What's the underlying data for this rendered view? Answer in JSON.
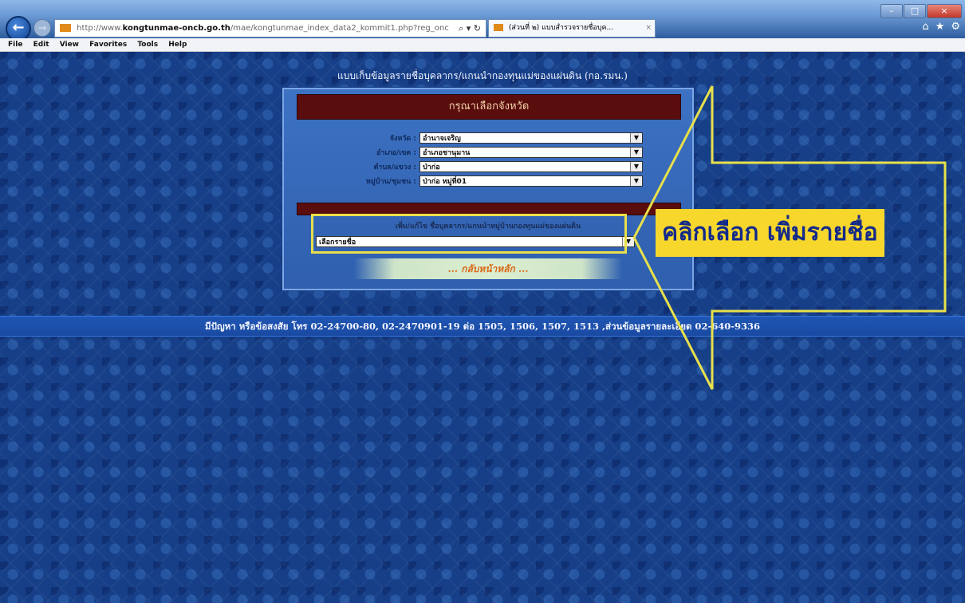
{
  "browser": {
    "address_prefix": "http://www.",
    "address_domain": "kongtunmae-oncb.go.th",
    "address_path": "/mae/kongtunmae_index_data2_kommit1.php?reg_onc",
    "tab_title": "(ส่วนที่ ๒) แบบสำรวจรายชื่อบุค...",
    "menu": [
      "File",
      "Edit",
      "View",
      "Favorites",
      "Tools",
      "Help"
    ]
  },
  "page": {
    "header": "แบบเก็บข้อมูลรายชื่อบุคลากร/แกนนำกองทุนแม่ของแผ่นดิน (กอ.รมน.)",
    "panel_title": "กรุณาเลือกจังหวัด",
    "fields": [
      {
        "label": "จังหวัด :",
        "value": "อำนาจเจริญ"
      },
      {
        "label": "อำเภอ/เขต :",
        "value": "อำเภอชานุมาน"
      },
      {
        "label": "ตำบล/แขวง :",
        "value": "ป่าก่อ"
      },
      {
        "label": "หมู่บ้าน/ชุมชน :",
        "value": "ป่าก่อ หมู่ที่01"
      }
    ],
    "add_caption": "เพิ่ม/แก้ไข ชื่อบุคลากร/แกนนำหมู่บ้านกองทุนแม่ของแผ่นดิน",
    "member_select": "เลือกรายชื่อ",
    "home_link": "... กลับหน้าหลัก ...",
    "footer": "มีปัญหา หรือข้อสงสัย โทร 02-24700-80, 02-2470901-19 ต่อ 1505, 1506, 1507, 1513 ,ส่วนข้อมูลรายละเอียด 02-640-9336"
  },
  "annotation": {
    "label": "คลิกเลือก เพิ่มรายชื่อ",
    "color": "#e8e04a"
  }
}
